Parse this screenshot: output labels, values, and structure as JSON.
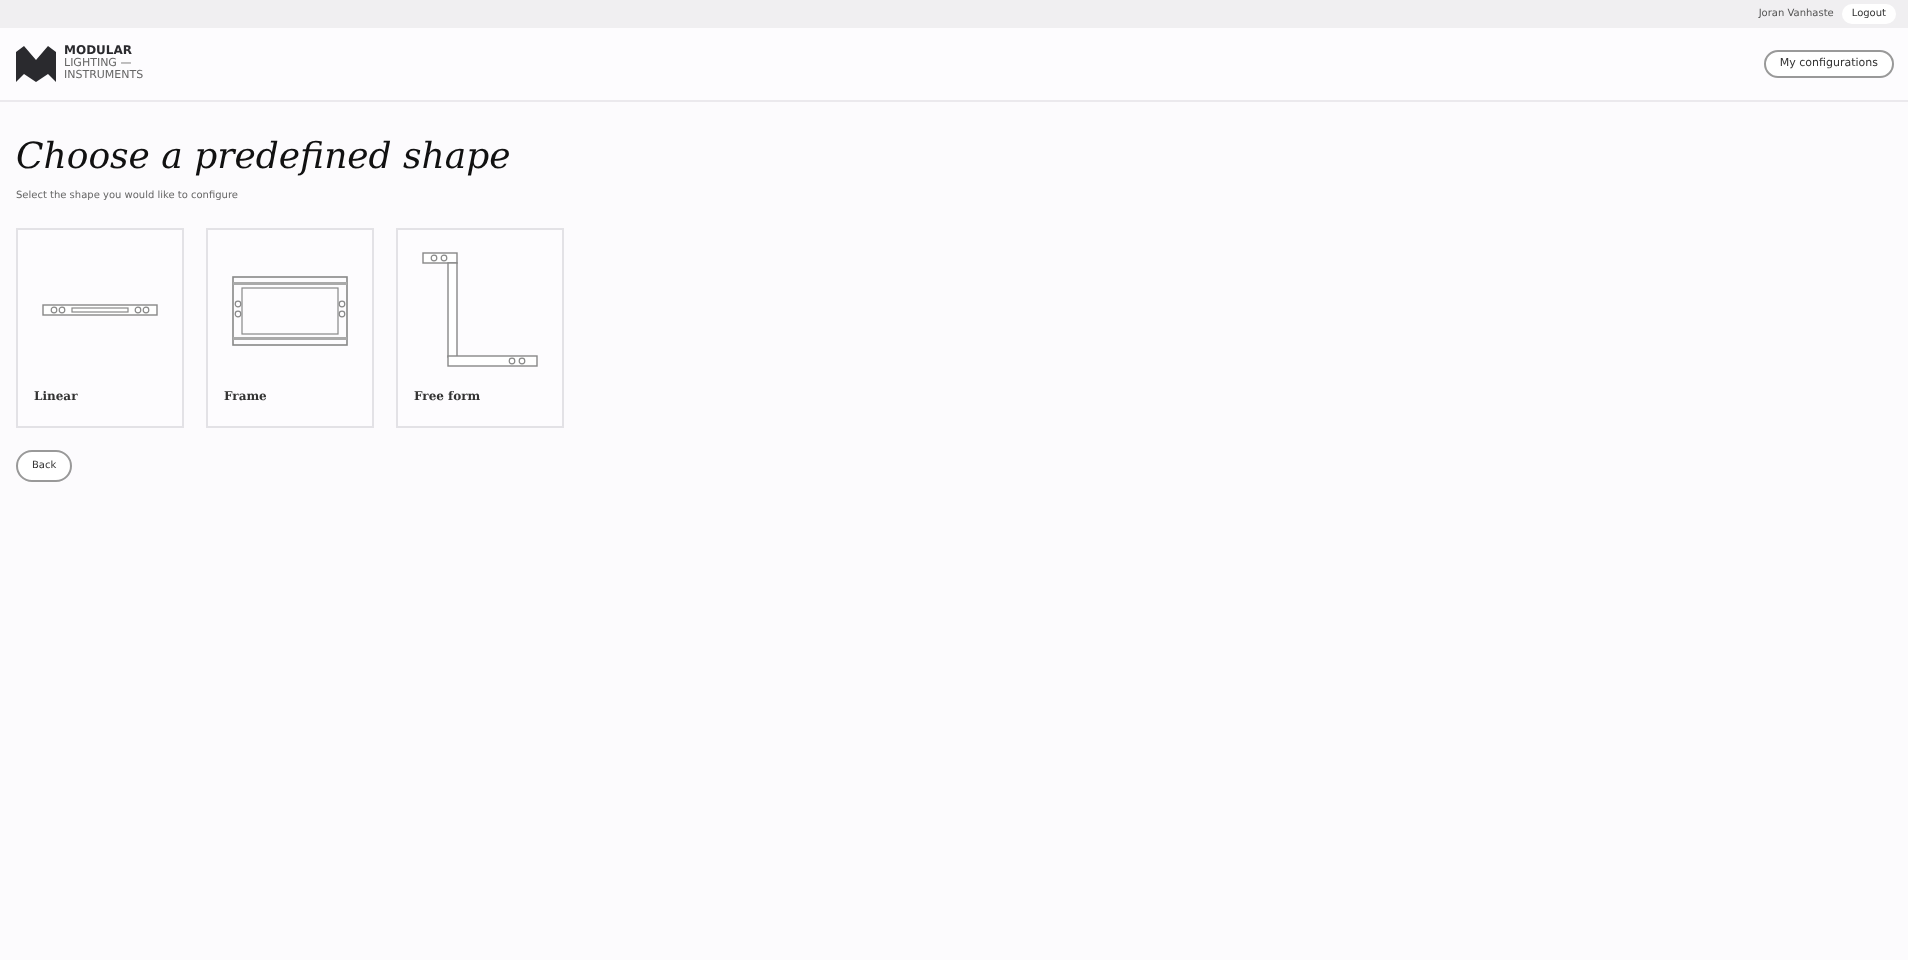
{
  "topbar": {
    "user": "Joran Vanhaste",
    "logout": "Logout"
  },
  "logo": {
    "line1": "MODULAR",
    "line2": "LIGHTING —",
    "line3": "INSTRUMENTS"
  },
  "header": {
    "my_configurations": "My configurations"
  },
  "title": "Choose a predefined shape",
  "subtitle": "Select the shape you would like to configure",
  "shapes": [
    {
      "kind": "linear",
      "label": "Linear"
    },
    {
      "kind": "frame",
      "label": "Frame"
    },
    {
      "kind": "freeform",
      "label": "Free form"
    }
  ],
  "back": "Back"
}
